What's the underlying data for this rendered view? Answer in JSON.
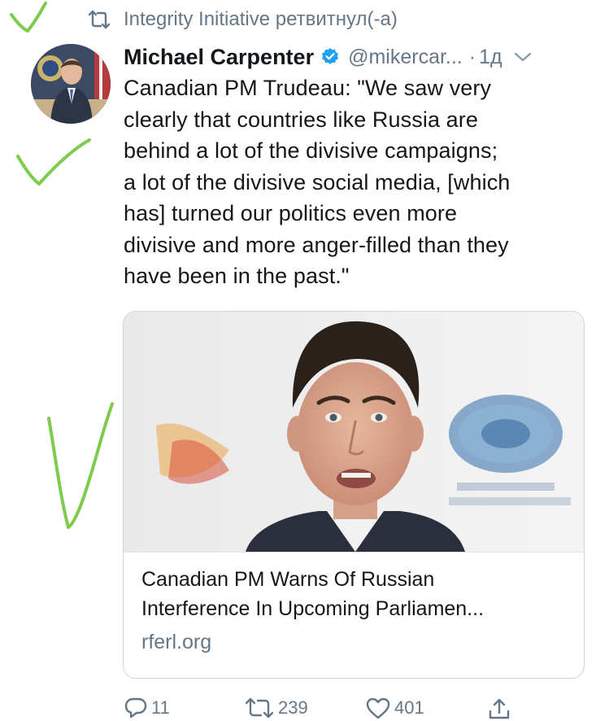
{
  "retweet_notice": {
    "icon": "retweet-icon",
    "text": "Integrity Initiative ретвитнул(-а)"
  },
  "tweet": {
    "author_name": "Michael Carpenter",
    "verified_icon": "verified-badge-icon",
    "handle": "@mikercar...",
    "separator": "·",
    "time": "1д",
    "menu_icon": "chevron-down-icon",
    "text": "Canadian PM Trudeau: \"We saw very\nclearly that countries like Russia are\nbehind a lot of the divisive campaigns;\na lot of the divisive social media, [which\nhas] turned our politics even more\ndivisive and more anger-filled than they\nhave been in the past.\""
  },
  "link_card": {
    "image_icon": "card-photo",
    "title": "Canadian PM Warns Of Russian\nInterference In Upcoming Parliamen...",
    "domain": "rferl.org"
  },
  "actions": {
    "reply": {
      "icon": "reply-icon",
      "count": "11"
    },
    "retweet": {
      "icon": "retweet-icon",
      "count": "239"
    },
    "like": {
      "icon": "heart-icon",
      "count": "401"
    },
    "share": {
      "icon": "share-icon"
    }
  },
  "colors": {
    "text": "#14171a",
    "secondary": "#657786",
    "verified": "#1da1f2",
    "border": "#ccd6dd",
    "annotation": "#7ecb4e"
  }
}
